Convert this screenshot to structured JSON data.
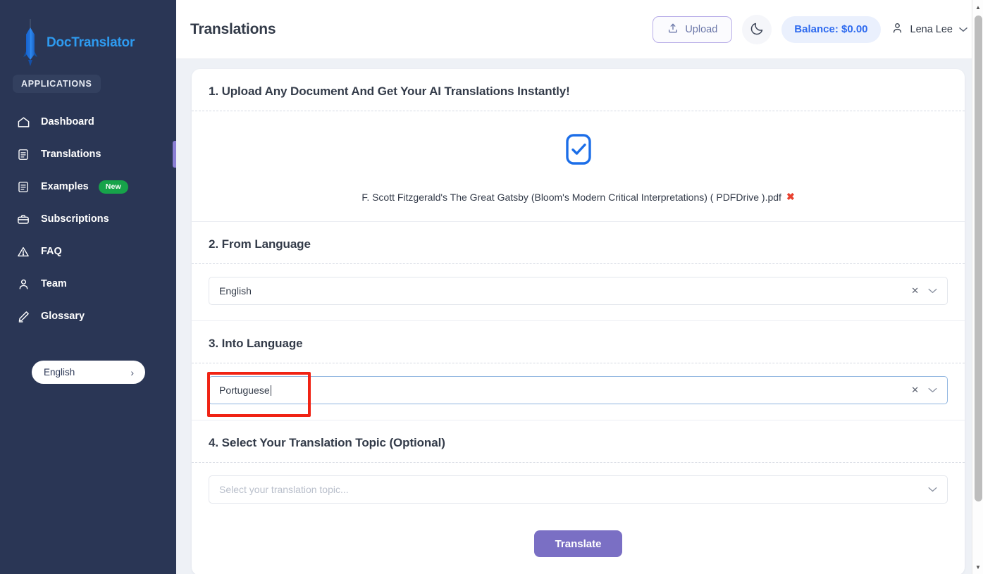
{
  "sidebar": {
    "brand": "DocTranslator",
    "brand_logo_icon": "rocket-icon",
    "section_label": "APPLICATIONS",
    "items": [
      {
        "label": "Dashboard",
        "icon": "home-icon",
        "badge": "",
        "active": false
      },
      {
        "label": "Translations",
        "icon": "document-icon",
        "badge": "",
        "active": true
      },
      {
        "label": "Examples",
        "icon": "document-icon",
        "badge": "New",
        "active": false
      },
      {
        "label": "Subscriptions",
        "icon": "briefcase-icon",
        "badge": "",
        "active": false
      },
      {
        "label": "FAQ",
        "icon": "warning-triangle-icon",
        "badge": "",
        "active": false
      },
      {
        "label": "Team",
        "icon": "user-icon",
        "badge": "",
        "active": false
      },
      {
        "label": "Glossary",
        "icon": "pen-icon",
        "badge": "",
        "active": false
      }
    ],
    "language_switch": {
      "label": "English",
      "chevron": "›"
    }
  },
  "topbar": {
    "title": "Translations",
    "upload_label": "Upload",
    "upload_icon": "upload-icon",
    "theme_toggle_icon": "moon-icon",
    "balance_label": "Balance: $0.00",
    "user_icon": "person-icon",
    "user_name": "Lena Lee",
    "user_chevron": "⌄"
  },
  "steps": {
    "step1": {
      "heading": "1. Upload Any Document And Get Your AI Translations Instantly!",
      "status_icon": "check-square-icon",
      "file_name": "F. Scott Fitzgerald's The Great Gatsby (Bloom's Modern Critical Interpretations) ( PDFDrive ).pdf",
      "remove_icon": "✖"
    },
    "step2": {
      "heading": "2. From Language",
      "value": "English",
      "clear_icon": "✕",
      "chevron_icon": "⌄"
    },
    "step3": {
      "heading": "3. Into Language",
      "value": "Portuguese",
      "clear_icon": "✕",
      "chevron_icon": "⌄",
      "focused": true
    },
    "step4": {
      "heading": "4. Select Your Translation Topic (Optional)",
      "placeholder": "Select your translation topic...",
      "chevron_icon": "⌄"
    }
  },
  "actions": {
    "translate_label": "Translate"
  },
  "colors": {
    "sidebar_bg": "#2a3655",
    "brand_blue": "#2e9bf0",
    "accent_purple": "#7a6fc4",
    "active_indicator": "#8b7fd4",
    "badge_green": "#17a34a",
    "balance_blue": "#2f6bef",
    "annotation_red": "#f02314",
    "page_bg": "#eef1f6"
  }
}
